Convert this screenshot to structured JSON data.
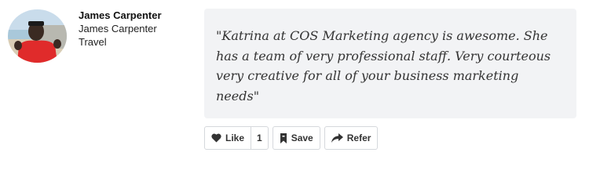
{
  "review": {
    "author": {
      "name": "James Carpenter",
      "company": "James Carpenter Travel"
    },
    "quote": "\"Katrina at COS Marketing agency is awesome. She has a team of very professional staff. Very courteous very creative for all of your business marketing needs\""
  },
  "actions": {
    "like_label": "Like",
    "like_count": "1",
    "save_label": "Save",
    "refer_label": "Refer"
  },
  "icons": {
    "like": "heart-icon",
    "save": "bookmark-icon",
    "refer": "share-arrow-icon"
  }
}
